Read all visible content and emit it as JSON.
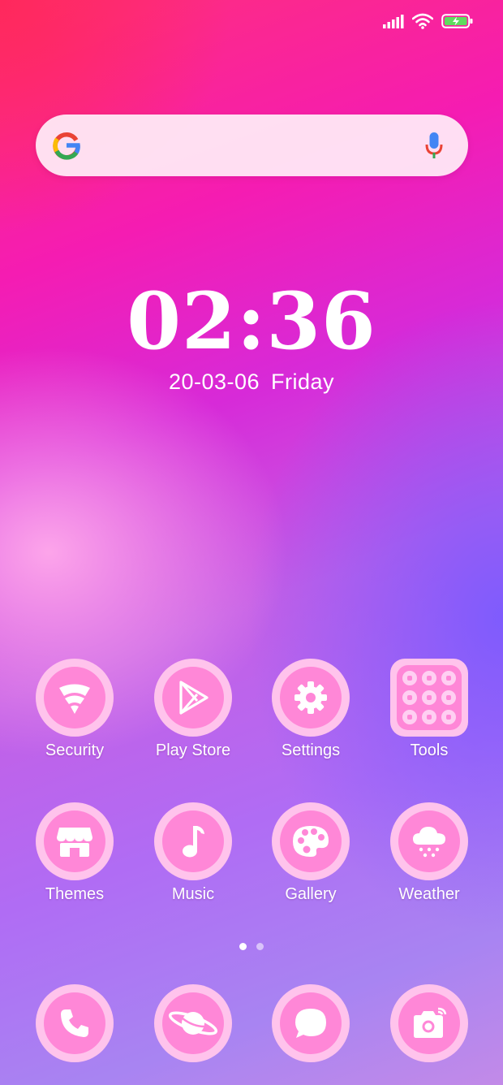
{
  "status_bar": {
    "icons": [
      "signal-icon",
      "wifi-icon",
      "battery-charging-icon"
    ]
  },
  "search_bar": {
    "icons": [
      "google-logo",
      "mic-icon"
    ]
  },
  "clock": {
    "time": "02:36",
    "date": "20-03-06",
    "weekday": "Friday"
  },
  "apps_row1": [
    {
      "label": "Security",
      "icon": "security-shield-icon"
    },
    {
      "label": "Play Store",
      "icon": "play-store-icon"
    },
    {
      "label": "Settings",
      "icon": "gear-icon"
    },
    {
      "label": "Tools",
      "icon": "folder-grid-icon"
    }
  ],
  "apps_row2": [
    {
      "label": "Themes",
      "icon": "store-awning-icon"
    },
    {
      "label": "Music",
      "icon": "music-note-icon"
    },
    {
      "label": "Gallery",
      "icon": "palette-icon"
    },
    {
      "label": "Weather",
      "icon": "snow-cloud-icon"
    }
  ],
  "pager": {
    "pages": 2,
    "current": 1
  },
  "dock": [
    {
      "icon": "phone-icon"
    },
    {
      "icon": "planet-icon"
    },
    {
      "icon": "chat-bubble-icon"
    },
    {
      "icon": "camera-icon"
    }
  ],
  "colors": {
    "icon_outer": "#ffc3ec",
    "icon_inner": "#ff87d7",
    "text": "#ffffff"
  }
}
